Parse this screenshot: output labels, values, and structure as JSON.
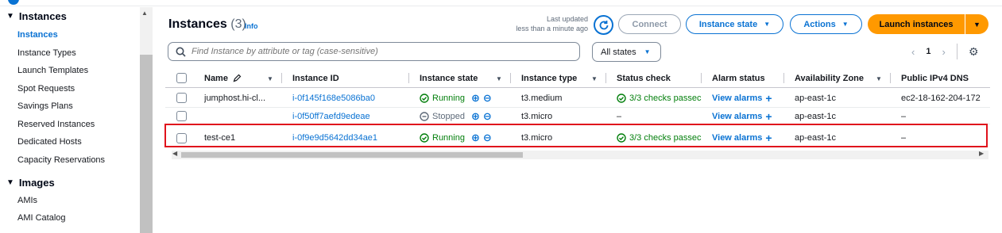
{
  "sidebar": {
    "section_instances": "Instances",
    "items": [
      "Instances",
      "Instance Types",
      "Launch Templates",
      "Spot Requests",
      "Savings Plans",
      "Reserved Instances",
      "Dedicated Hosts",
      "Capacity Reservations"
    ],
    "section_images": "Images",
    "image_items": [
      "AMIs",
      "AMI Catalog"
    ]
  },
  "header": {
    "title": "Instances",
    "count": "(3)",
    "info": "Info",
    "last_updated_1": "Last updated",
    "last_updated_2": "less than a minute ago",
    "connect": "Connect",
    "instance_state": "Instance state",
    "actions": "Actions",
    "launch": "Launch instances"
  },
  "filter": {
    "search_placeholder": "Find Instance by attribute or tag (case-sensitive)",
    "state_filter": "All states",
    "page": "1"
  },
  "table": {
    "columns": [
      "Name",
      "Instance ID",
      "Instance state",
      "Instance type",
      "Status check",
      "Alarm status",
      "Availability Zone",
      "Public IPv4 DNS"
    ],
    "rows": [
      {
        "name": "jumphost.hi-cl...",
        "id": "i-0f145f168e5086ba0",
        "state": "Running",
        "type": "t3.medium",
        "status": "3/3 checks passec",
        "alarm": "View alarms",
        "az": "ap-east-1c",
        "dns": "ec2-18-162-204-172"
      },
      {
        "name": "",
        "id": "i-0f50ff7aefd9edeae",
        "state": "Stopped",
        "type": "t3.micro",
        "status": "–",
        "alarm": "View alarms",
        "az": "ap-east-1c",
        "dns": "–"
      },
      {
        "name": "test-ce1",
        "id": "i-0f9e9d5642dd34ae1",
        "state": "Running",
        "type": "t3.micro",
        "status": "3/3 checks passec",
        "alarm": "View alarms",
        "az": "ap-east-1c",
        "dns": "–"
      }
    ]
  }
}
